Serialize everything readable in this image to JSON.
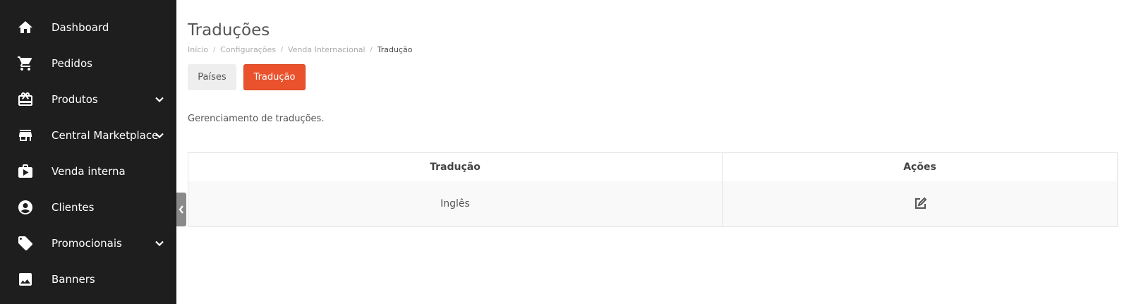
{
  "sidebar": {
    "items": [
      {
        "label": "Dashboard",
        "icon": "home-icon"
      },
      {
        "label": "Pedidos",
        "icon": "cart-icon"
      },
      {
        "label": "Produtos",
        "icon": "gift-box-icon",
        "expandable": true
      },
      {
        "label": "Central Marketplace",
        "icon": "store-icon",
        "expandable": true
      },
      {
        "label": "Venda interna",
        "icon": "play-briefcase-icon"
      },
      {
        "label": "Clientes",
        "icon": "user-circle-icon"
      },
      {
        "label": "Promocionais",
        "icon": "tag-icon",
        "expandable": true
      },
      {
        "label": "Banners",
        "icon": "image-icon"
      }
    ]
  },
  "header": {
    "title": "Traduções",
    "breadcrumb": [
      "Início",
      "Configurações",
      "Venda Internacional",
      "Tradução"
    ]
  },
  "tabs": {
    "paises": "Países",
    "traducao": "Tradução"
  },
  "description": "Gerenciamento de traduções.",
  "table": {
    "columns": [
      "Tradução",
      "Ações"
    ],
    "rows": [
      {
        "traducao": "Inglês",
        "acao_icon": "edit-icon"
      }
    ]
  },
  "colors": {
    "sidebar_bg": "#1e1e1e",
    "accent": "#e9522c"
  }
}
